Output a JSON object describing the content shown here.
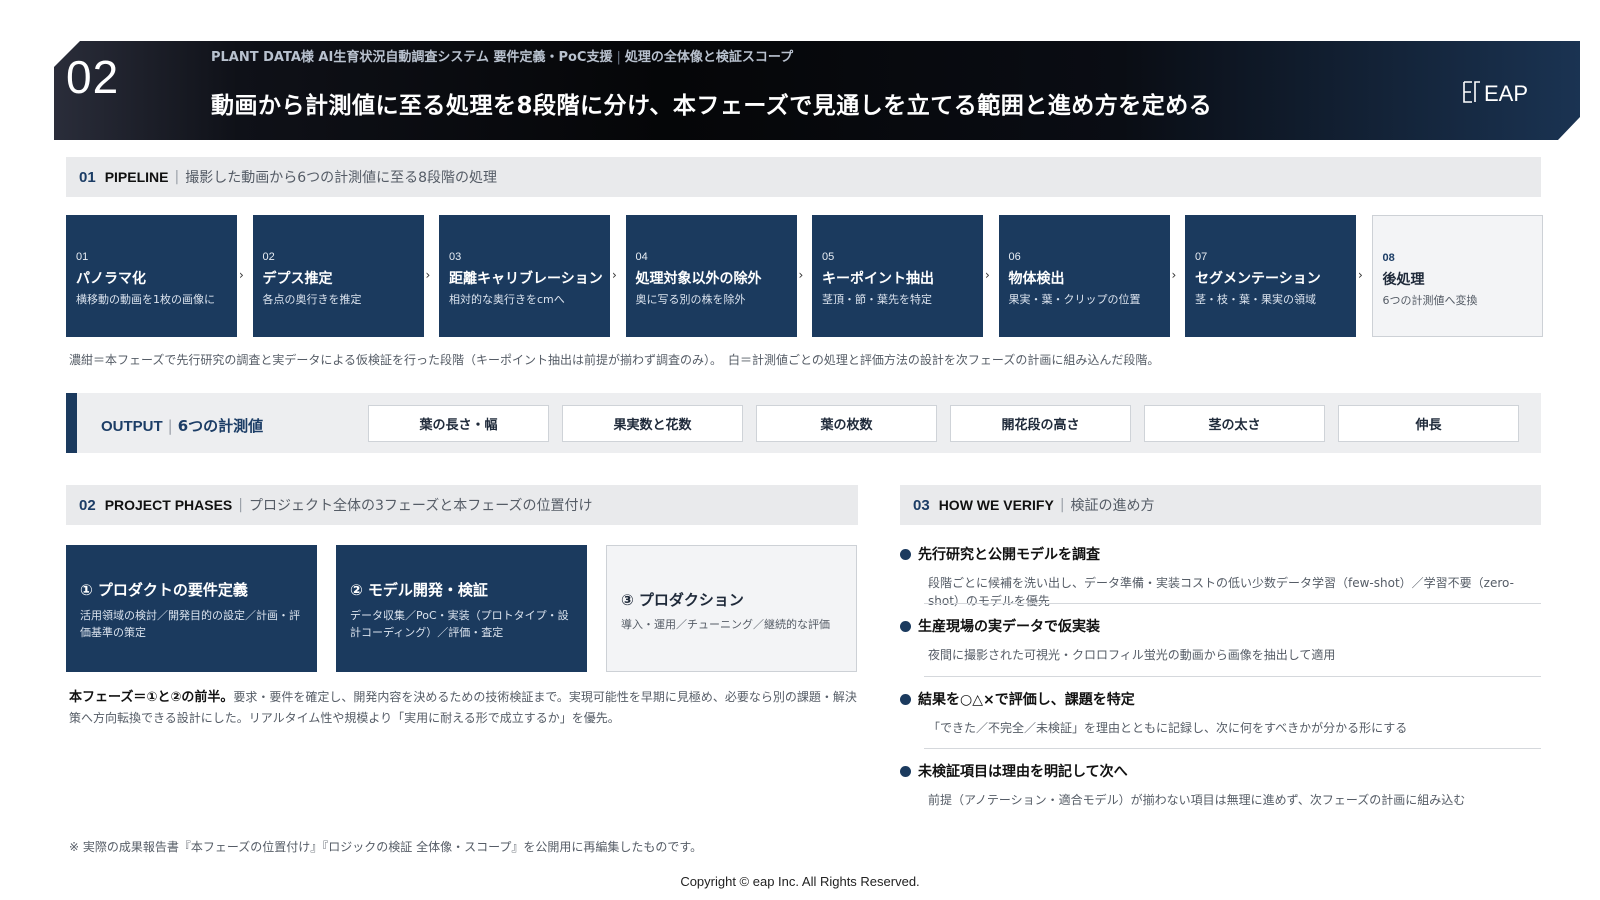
{
  "header": {
    "number": "02",
    "subtitle_left": "PLANT DATA様 AI生育状況自動調査システム 要件定義・PoC支援",
    "subtitle_sep": "|",
    "subtitle_right": "処理の全体像と検証スコープ",
    "title": "動画から計測値に至る処理を8段階に分け、本フェーズで見通しを立てる範囲と進め方を定める",
    "logo_text": "EAP"
  },
  "pipeline": {
    "num": "01",
    "en": "PIPELINE",
    "jp": "撮影した動画から6つの計測値に至る8段階の処理",
    "arrow": "›",
    "steps": [
      {
        "num": "01",
        "title": "パノラマ化",
        "desc": "横移動の動画を1枚の画像に"
      },
      {
        "num": "02",
        "title": "デプス推定",
        "desc": "各点の奥行きを推定"
      },
      {
        "num": "03",
        "title": "距離キャリブレーション",
        "desc": "相対的な奥行きをcmへ"
      },
      {
        "num": "04",
        "title": "処理対象以外の除外",
        "desc": "奥に写る別の株を除外"
      },
      {
        "num": "05",
        "title": "キーポイント抽出",
        "desc": "茎頂・節・葉先を特定"
      },
      {
        "num": "06",
        "title": "物体検出",
        "desc": "果実・葉・クリップの位置"
      },
      {
        "num": "07",
        "title": "セグメンテーション",
        "desc": "茎・枝・葉・果実の領域"
      },
      {
        "num": "08",
        "title": "後処理",
        "desc": "6つの計測値へ変換"
      }
    ],
    "note": "濃紺＝本フェーズで先行研究の調査と実データによる仮検証を行った段階（キーポイント抽出は前提が揃わず調査のみ）。　白＝計測値ごとの処理と評価方法の設計を次フェーズの計画に組み込んだ段階。"
  },
  "output": {
    "en": "OUTPUT",
    "sep": "|",
    "jp": "6つの計測値",
    "items": [
      "葉の長さ・幅",
      "果実数と花数",
      "葉の枚数",
      "開花段の高さ",
      "茎の太さ",
      "伸長"
    ]
  },
  "phases": {
    "num": "02",
    "en": "PROJECT PHASES",
    "jp": "プロジェクト全体の3フェーズと本フェーズの位置付け",
    "items": [
      {
        "title": "① プロダクトの要件定義",
        "desc": "活用領域の検討／開発目的の設定／計画・評価基準の策定"
      },
      {
        "title": "② モデル開発・検証",
        "desc": "データ収集／PoC・実装（プロトタイプ・設計コーディング）／評価・査定"
      },
      {
        "title": "③ プロダクション",
        "desc": "導入・運用／チューニング／継続的な評価"
      }
    ],
    "note_bold": "本フェーズ＝①と②の前半。",
    "note_text": "要求・要件を確定し、開発内容を決めるための技術検証まで。実現可能性を早期に見極め、必要なら別の課題・解決策へ方向転換できる設計にした。リアルタイム性や規模より「実用に耐える形で成立するか」を優先。"
  },
  "verify": {
    "num": "03",
    "en": "HOW WE VERIFY",
    "jp": "検証の進め方",
    "items": [
      {
        "title": "先行研究と公開モデルを調査",
        "desc": "段階ごとに候補を洗い出し、データ準備・実装コストの低い少数データ学習（few-shot）／学習不要（zero-shot）のモデルを優先"
      },
      {
        "title": "生産現場の実データで仮実装",
        "desc": "夜間に撮影された可視光・クロロフィル蛍光の動画から画像を抽出して適用"
      },
      {
        "title": "結果を○△×で評価し、課題を特定",
        "desc": "「できた／不完全／未検証」を理由とともに記録し、次に何をすべきかが分かる形にする"
      },
      {
        "title": "未検証項目は理由を明記して次へ",
        "desc": "前提（アノテーション・適合モデル）が揃わない項目は無理に進めず、次フェーズの計画に組み込む"
      }
    ]
  },
  "footnote": "※ 実際の成果報告書『本フェーズの位置付け』『ロジックの検証 全体像・スコープ』を公開用に再編集したものです。",
  "copyright": "Copyright © eap Inc. All Rights Reserved.",
  "colors": {
    "navy": "#1b3a5e",
    "panel": "#e9eaec",
    "text": "#555c66"
  }
}
